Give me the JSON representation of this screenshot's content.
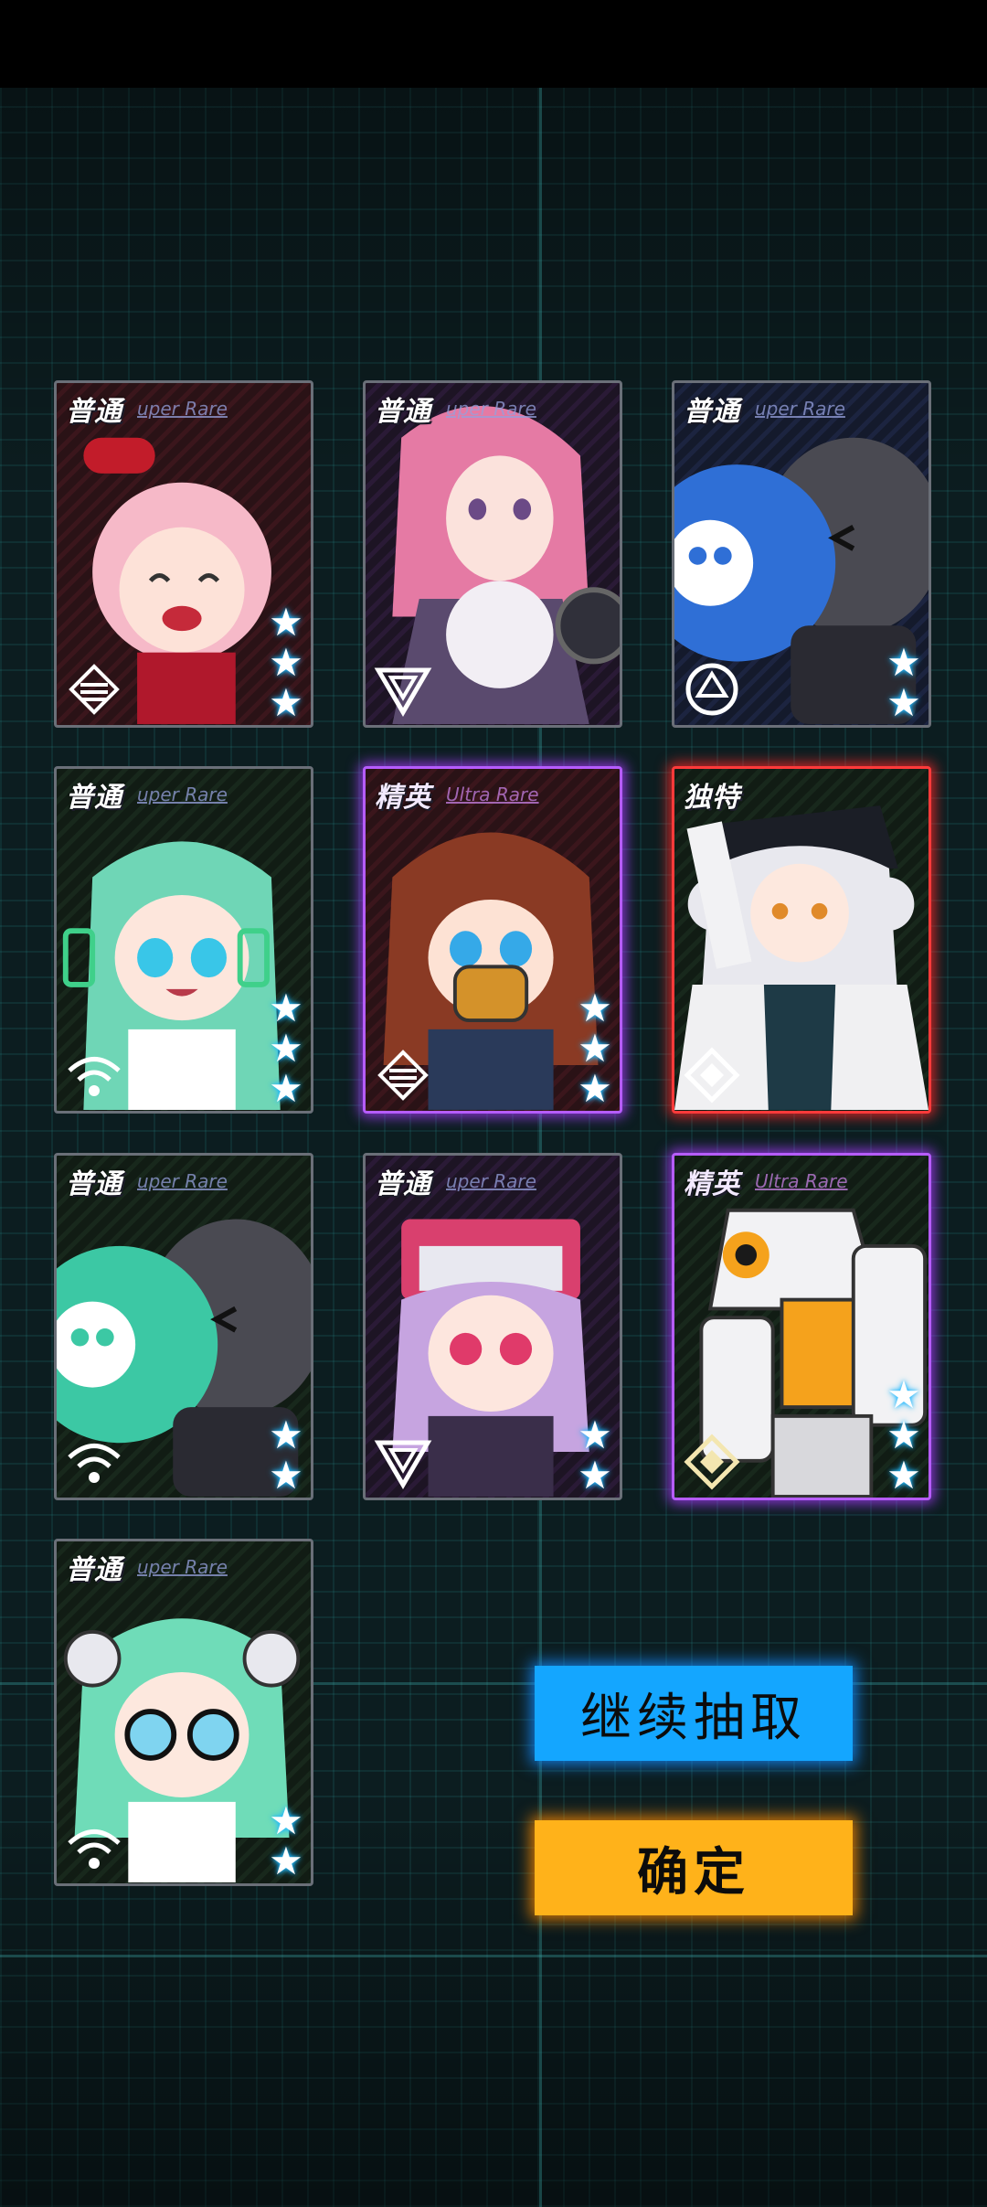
{
  "cards": [
    {
      "tier": "普通",
      "rarity": "uper Rare",
      "stars": 3,
      "class_icon": "sword-class-icon",
      "theme": "red"
    },
    {
      "tier": "普通",
      "rarity": "uper Rare",
      "stars": 0,
      "class_icon": "shield-class-icon",
      "theme": "purple"
    },
    {
      "tier": "普通",
      "rarity": "uper Rare",
      "stars": 2,
      "class_icon": "target-class-icon",
      "theme": "blue"
    },
    {
      "tier": "普通",
      "rarity": "uper Rare",
      "stars": 3,
      "class_icon": "signal-class-icon",
      "theme": "green"
    },
    {
      "tier": "精英",
      "rarity": "Ultra Rare",
      "stars": 3,
      "class_icon": "sword-class-icon",
      "theme": "red"
    },
    {
      "tier": "独特",
      "rarity": "",
      "stars": 0,
      "class_icon": "diamond-class-icon",
      "theme": "green"
    },
    {
      "tier": "普通",
      "rarity": "uper Rare",
      "stars": 2,
      "class_icon": "signal-class-icon",
      "theme": "green"
    },
    {
      "tier": "普通",
      "rarity": "uper Rare",
      "stars": 2,
      "class_icon": "shield-class-icon",
      "theme": "purple"
    },
    {
      "tier": "精英",
      "rarity": "Ultra Rare",
      "stars": 3,
      "class_icon": "diamond-class-icon",
      "theme": "green"
    },
    {
      "tier": "普通",
      "rarity": "uper Rare",
      "stars": 2,
      "class_icon": "signal-class-icon",
      "theme": "green"
    }
  ],
  "buttons": {
    "continue_label": "继续抽取",
    "confirm_label": "确定"
  },
  "colors": {
    "continue_bg": "#14a6ff",
    "confirm_bg": "#ffb21a",
    "elite_glow": "#b65cff",
    "unique_glow": "#ff3a3a",
    "star": "#1fb8ff"
  }
}
